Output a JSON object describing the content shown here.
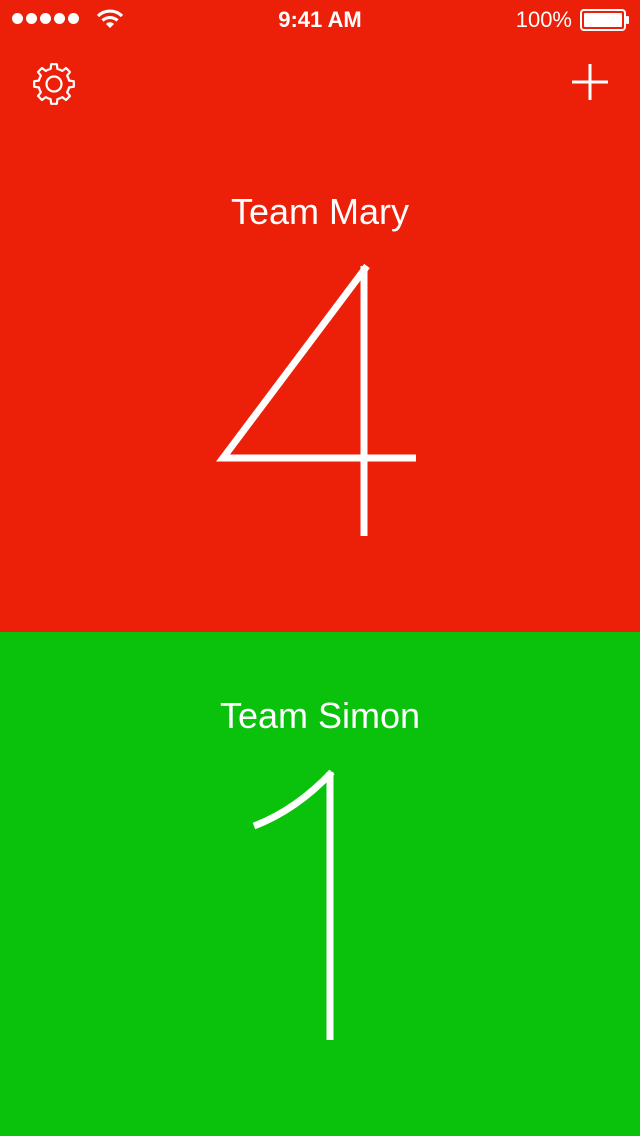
{
  "status_bar": {
    "time": "9:41 AM",
    "battery": "100%",
    "signal_bars": 5,
    "wifi_icon": "wifi-icon",
    "battery_icon": "battery-icon"
  },
  "toolbar": {
    "settings_icon": "gear-icon",
    "add_icon": "plus-icon"
  },
  "teams": [
    {
      "name": "Team Mary",
      "score": "4",
      "color": "#ec1f09"
    },
    {
      "name": "Team Simon",
      "score": "1",
      "color": "#0ac20c"
    }
  ]
}
